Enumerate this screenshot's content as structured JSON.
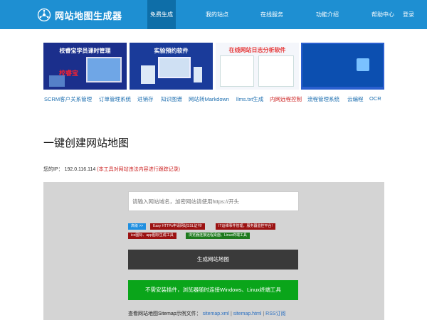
{
  "header": {
    "logo_text": "网站地图生成器",
    "nav": [
      {
        "label": "免费生成",
        "active": true
      },
      {
        "label": "我的站点",
        "active": false
      },
      {
        "label": "在线服务",
        "active": false
      },
      {
        "label": "功能介绍",
        "active": false
      },
      {
        "label": "帮助中心",
        "active": false
      },
      {
        "label": "登录",
        "active": false
      }
    ],
    "colors": {
      "bar": "#1e8fd2",
      "active": "#0e6ea8"
    }
  },
  "banners": [
    {
      "title": "校睿宝学员课时管理",
      "badge": "校睿宝"
    },
    {
      "title": "实验预约软件"
    },
    {
      "title": "在线网站日志分析软件"
    },
    {
      "title": ""
    }
  ],
  "links": [
    {
      "label": "SCRM客户关系管理"
    },
    {
      "label": "订单管理系统"
    },
    {
      "label": "进销存"
    },
    {
      "label": "知识图谱"
    },
    {
      "label": "网站转Markdown"
    },
    {
      "label": "llms.txt生成"
    },
    {
      "label": "内网远程控制",
      "highlight": true
    },
    {
      "label": "流程管理系统"
    },
    {
      "label": "云编程"
    },
    {
      "label": "OCR"
    }
  ],
  "page": {
    "title": "一键创建网站地图",
    "ip_label": "您的IP：",
    "ip_value": "192.0.116.114",
    "ip_warning": "(本工具对网站违法内容进行跟踪记录)"
  },
  "form": {
    "url_placeholder": "请输入网站域名，加密网站请使用https://开头",
    "tags": [
      {
        "label": "高级 >>",
        "kind": "adv"
      },
      {
        "label": "Easy HTTPs申请网站SSL证书!",
        "kind": "red"
      },
      {
        "label": "IT运维事件管理，服务器监控平台!",
        "kind": "red"
      },
      {
        "label": "ico图标、app图标生成工具",
        "kind": "red"
      },
      {
        "label": "浏览器连接远程桌面、Linux终端工具",
        "kind": "green"
      }
    ],
    "generate_label": "生成网站地图",
    "green_label": "不需安装插件，浏览器随时连接Windows、Linux终端工具",
    "example_prefix": "查看网站地图Sitemap示例文件：",
    "example_links": [
      "sitemap.xml",
      "sitemap.html",
      "RSS订阅"
    ]
  }
}
